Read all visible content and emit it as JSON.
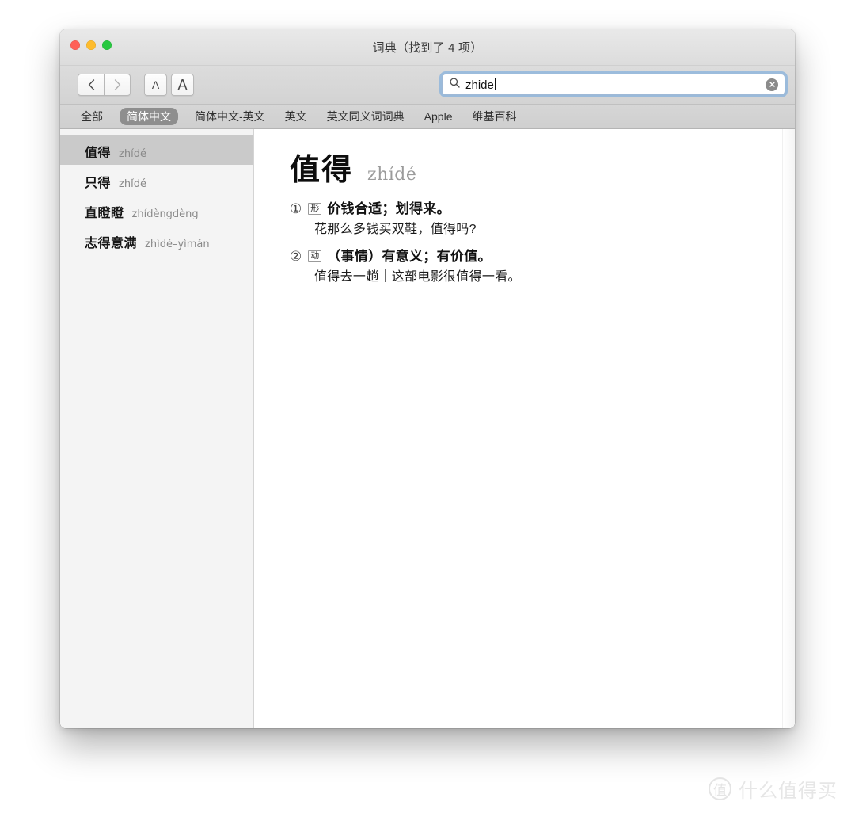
{
  "window": {
    "title": "词典（找到了 4 项）",
    "traffic_lights": [
      {
        "name": "close",
        "color": "#ff5f57"
      },
      {
        "name": "minimize",
        "color": "#febc2e"
      },
      {
        "name": "zoom",
        "color": "#28c840"
      }
    ]
  },
  "toolbar": {
    "back_label": "‹",
    "forward_label": "›",
    "font_smaller_label": "A",
    "font_larger_label": "A",
    "search": {
      "icon": "search-icon",
      "value": "zhide",
      "placeholder": "搜索",
      "clear_icon": "clear-circle-icon"
    }
  },
  "tabs": [
    {
      "label": "全部",
      "selected": false
    },
    {
      "label": "简体中文",
      "selected": true
    },
    {
      "label": "简体中文-英文",
      "selected": false
    },
    {
      "label": "英文",
      "selected": false
    },
    {
      "label": "英文同义词词典",
      "selected": false
    },
    {
      "label": "Apple",
      "selected": false
    },
    {
      "label": "维基百科",
      "selected": false
    }
  ],
  "sidebar": {
    "items": [
      {
        "word": "值得",
        "pinyin": "zhídé",
        "selected": true
      },
      {
        "word": "只得",
        "pinyin": "zhǐdé",
        "selected": false
      },
      {
        "word": "直瞪瞪",
        "pinyin": "zhídèngdèng",
        "selected": false
      },
      {
        "word": "志得意满",
        "pinyin": "zhìdé–yìmǎn",
        "selected": false
      }
    ]
  },
  "entry": {
    "headword": "值得",
    "pinyin": "zhídé",
    "senses": [
      {
        "number": "①",
        "pos": "形",
        "definition": "价钱合适；划得来。",
        "example": "花那么多钱买双鞋，值得吗?"
      },
      {
        "number": "②",
        "pos": "动",
        "definition": "（事情）有意义；有价值。",
        "example": "值得去一趟｜这部电影很值得一看。"
      }
    ]
  },
  "watermark": {
    "logo_text": "值",
    "text": "什么值得买"
  }
}
